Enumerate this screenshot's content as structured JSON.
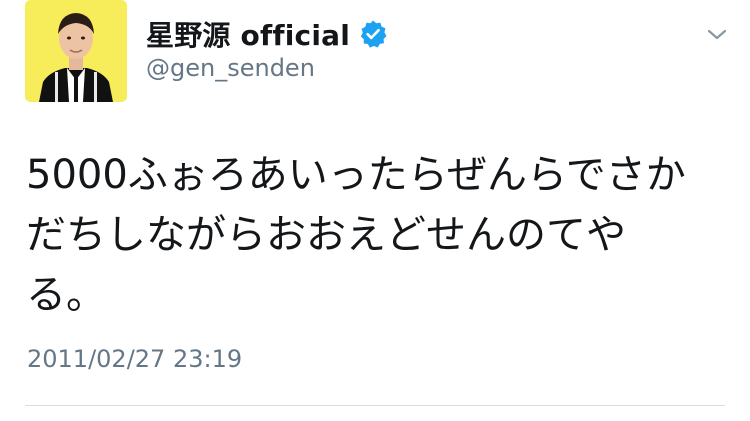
{
  "tweet": {
    "display_name": "星野源 official",
    "handle": "@gen_senden",
    "text_lines": [
      "5000ふぉろあいったらぜんらでさか",
      "だちしながらおおえどせんのてや",
      "る。"
    ],
    "timestamp": "2011/02/27 23:19",
    "icons": {
      "verified": "verified-badge-icon",
      "menu": "chevron-down-icon"
    },
    "colors": {
      "avatar_background": "#f7ec5a",
      "verified": "#1da1f2",
      "text": "#14171a",
      "secondary_text": "#657786"
    }
  }
}
